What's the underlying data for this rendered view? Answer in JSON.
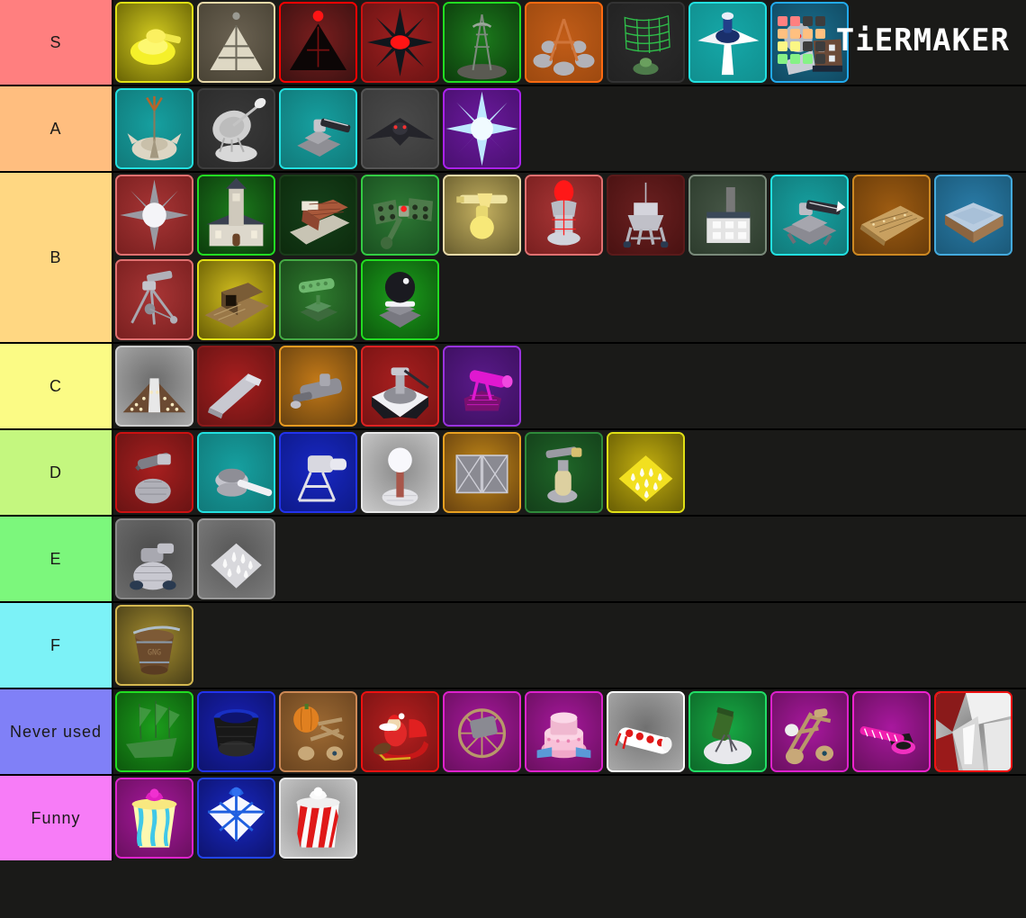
{
  "brand": {
    "name": "TiERMAKER",
    "logo_icon": "tiermaker-grid-logo",
    "grid_colors": [
      "#ff8080",
      "#ff8080",
      "#3d3d3d",
      "#3d3d3d",
      "#ffc080",
      "#ffc080",
      "#ffc080",
      "#ffc080",
      "#fbf785",
      "#fbf785",
      "#3d3d3d",
      "#3d3d3d",
      "#86f286",
      "#86f286",
      "#86f286",
      "#3d3d3d"
    ]
  },
  "background_color": "#1a1a18",
  "tiers": [
    {
      "label": "S",
      "color": "#ff7f7f",
      "items": [
        {
          "name": "yellow-tank-turret",
          "bg": "#6b6605",
          "bg2": "#d4cc20",
          "border": "#e0e015",
          "art": "tank"
        },
        {
          "name": "white-pyramid-structure",
          "bg": "#4a4436",
          "bg2": "#6b6252",
          "border": "#e8d9a8",
          "art": "pyramid-white"
        },
        {
          "name": "black-red-pyramid",
          "bg": "#3d1212",
          "bg2": "#7a1e1e",
          "border": "#ff0000",
          "art": "pyramid-dark"
        },
        {
          "name": "red-core-spike-burst",
          "bg": "#6b1414",
          "bg2": "#9e1f1f",
          "border": "#cc1111",
          "art": "spike-burst-red"
        },
        {
          "name": "green-radio-tower",
          "bg": "#0d3d0d",
          "bg2": "#1c7a1c",
          "border": "#22dd22",
          "art": "radio-tower"
        },
        {
          "name": "orange-stone-campfire",
          "bg": "#9e4a10",
          "bg2": "#c25d18",
          "border": "#ff6a10",
          "art": "campfire"
        },
        {
          "name": "green-solar-panel-array",
          "bg": "#222222",
          "bg2": "#2c2c2c",
          "border": "#333333",
          "art": "solar-array"
        },
        {
          "name": "teal-blue-aircraft",
          "bg": "#119090",
          "bg2": "#15a8a8",
          "border": "#22e0e0",
          "art": "jet-plane"
        },
        {
          "name": "blue-radar-base-building",
          "bg": "#104a63",
          "bg2": "#1b6e8c",
          "border": "#22aaee",
          "art": "radar-building"
        }
      ]
    },
    {
      "label": "A",
      "color": "#ffbe7f",
      "items": [
        {
          "name": "teal-antenna-dome",
          "bg": "#117a7a",
          "bg2": "#16a0a0",
          "border": "#22e0e0",
          "art": "antenna-dome"
        },
        {
          "name": "satellite-dish-grey",
          "bg": "#2b2b2b",
          "bg2": "#3a3a3a",
          "border": "#3d3d3d",
          "art": "satellite-dish"
        },
        {
          "name": "teal-artillery-platform",
          "bg": "#117a7a",
          "bg2": "#16a0a0",
          "border": "#22e0e0",
          "art": "artillery"
        },
        {
          "name": "stealth-bomber-grey",
          "bg": "#3a3a3a",
          "bg2": "#4a4a4a",
          "border": "#555555",
          "art": "stealth-bomber"
        },
        {
          "name": "purple-ice-star-burst",
          "bg": "#4a1070",
          "bg2": "#6b1a9e",
          "border": "#aa22ee",
          "art": "star-burst-ice"
        }
      ]
    },
    {
      "label": "B",
      "color": "#ffd782",
      "items": [
        {
          "name": "white-spiked-orb",
          "bg": "#7a2020",
          "bg2": "#a83535",
          "border": "#e07070",
          "art": "spiked-orb"
        },
        {
          "name": "green-church-building",
          "bg": "#0d3d0d",
          "bg2": "#1c7a1c",
          "border": "#22dd22",
          "art": "church"
        },
        {
          "name": "dark-brick-wall-platform",
          "bg": "#0d2b0d",
          "bg2": "#15401a",
          "border": "#1a3d1a",
          "art": "brick-wall"
        },
        {
          "name": "green-circuit-launcher",
          "bg": "#1a5020",
          "bg2": "#2e7a35",
          "border": "#33cc44",
          "art": "circuit-launcher"
        },
        {
          "name": "yellow-crane-hammer",
          "bg": "#6b6030",
          "bg2": "#c4b060",
          "border": "#e8d9a8",
          "art": "crane-hammer"
        },
        {
          "name": "red-capsule-silo",
          "bg": "#7a2020",
          "bg2": "#a83535",
          "border": "#e07070",
          "art": "capsule-silo"
        },
        {
          "name": "grey-drilling-rig",
          "bg": "#4a1212",
          "bg2": "#6b2020",
          "border": "#5a1a1a",
          "art": "drill-rig"
        },
        {
          "name": "factory-smokestack",
          "bg": "#2e3d2e",
          "bg2": "#455545",
          "border": "#7a8a7a",
          "art": "factory"
        },
        {
          "name": "teal-heavy-cannon",
          "bg": "#117a7a",
          "bg2": "#16a0a0",
          "border": "#22e0e0",
          "art": "heavy-cannon"
        },
        {
          "name": "wooden-plank-ramp",
          "bg": "#6b3d0a",
          "bg2": "#9e5c12",
          "border": "#cc8822",
          "art": "wood-ramp"
        },
        {
          "name": "blue-water-basin",
          "bg": "#1b5a7a",
          "bg2": "#2a7ca8",
          "border": "#44aadd",
          "art": "water-basin"
        },
        {
          "name": "red-tripod-launcher",
          "bg": "#7a2020",
          "bg2": "#a83535",
          "border": "#e07070",
          "art": "tripod-launcher"
        },
        {
          "name": "yellow-wooden-bunker",
          "bg": "#6b6005",
          "bg2": "#d4c020",
          "border": "#e0e015",
          "art": "bunker"
        },
        {
          "name": "green-gatling-turret",
          "bg": "#1a4a1a",
          "bg2": "#2e7a2e",
          "border": "#44aa44",
          "art": "gatling"
        },
        {
          "name": "green-black-dome-turret",
          "bg": "#0d5a0d",
          "bg2": "#1c9e1c",
          "border": "#22dd22",
          "art": "dome-turret"
        }
      ]
    },
    {
      "label": "C",
      "color": "#fbfb85",
      "items": [
        {
          "name": "grey-studded-ramp",
          "bg": "#a8a8a8",
          "bg2": "#6b6b6b",
          "border": "#cccccc",
          "art": "studded-ramp"
        },
        {
          "name": "red-grey-blade-ramp",
          "bg": "#6b1414",
          "bg2": "#a81f1f",
          "border": "#8a1a1a",
          "art": "blade-ramp"
        },
        {
          "name": "orange-grey-barrel",
          "bg": "#6b4410",
          "bg2": "#c47a18",
          "border": "#e89a20",
          "art": "barrel-cannon"
        },
        {
          "name": "red-radar-turret-platform",
          "bg": "#7a1414",
          "bg2": "#a81f1f",
          "border": "#dd2222",
          "art": "radar-turret"
        },
        {
          "name": "purple-magenta-cannon",
          "bg": "#3d1060",
          "bg2": "#5a1a8a",
          "border": "#9933dd",
          "art": "magenta-cannon"
        }
      ]
    },
    {
      "label": "D",
      "color": "#c4f77f",
      "items": [
        {
          "name": "red-mounted-machine-gun",
          "bg": "#6b1414",
          "bg2": "#a81f1f",
          "border": "#cc1111",
          "art": "machine-gun"
        },
        {
          "name": "teal-mortar-launcher",
          "bg": "#117a7a",
          "bg2": "#16a0a0",
          "border": "#22e0e0",
          "art": "mortar"
        },
        {
          "name": "blue-searchlight-tower",
          "bg": "#0e1a8a",
          "bg2": "#1828c4",
          "border": "#2233ee",
          "art": "searchlight"
        },
        {
          "name": "white-ball-antenna",
          "bg": "#c8c8c8",
          "bg2": "#8a8a8a",
          "border": "#e8e8e8",
          "art": "ball-antenna"
        },
        {
          "name": "orange-mesh-double-gate",
          "bg": "#6b4410",
          "bg2": "#c48a18",
          "border": "#e8a020",
          "art": "mesh-gate"
        },
        {
          "name": "green-fuel-tank-turret",
          "bg": "#14401a",
          "bg2": "#1f6628",
          "border": "#2e8a3a",
          "art": "fuel-turret"
        },
        {
          "name": "yellow-spike-trap-plate",
          "bg": "#6b6005",
          "bg2": "#c4b010",
          "border": "#e0e015",
          "art": "spike-plate-yellow"
        }
      ]
    },
    {
      "label": "E",
      "color": "#7cf77c",
      "items": [
        {
          "name": "grey-mesh-turret",
          "bg": "#6b6b6b",
          "bg2": "#4a4a4a",
          "border": "#888888",
          "art": "mesh-turret"
        },
        {
          "name": "grey-spike-trap-plate",
          "bg": "#7a7a7a",
          "bg2": "#555555",
          "border": "#999999",
          "art": "spike-plate-grey"
        }
      ]
    },
    {
      "label": "F",
      "color": "#7cf2f7",
      "items": [
        {
          "name": "brown-bucket-container",
          "bg": "#4a4018",
          "bg2": "#a89030",
          "border": "#d4b850",
          "art": "bucket"
        }
      ]
    },
    {
      "label": "Never used",
      "color": "#8080f7",
      "items": [
        {
          "name": "green-sailing-ship",
          "bg": "#0d5a0d",
          "bg2": "#1c9e1c",
          "border": "#22dd22",
          "art": "sail-ship"
        },
        {
          "name": "blue-mesh-drum",
          "bg": "#0e1470",
          "bg2": "#1820b8",
          "border": "#2233ee",
          "art": "drum"
        },
        {
          "name": "pumpkin-catapult",
          "bg": "#6b4520",
          "bg2": "#9e6a33",
          "border": "#cc8855",
          "art": "pumpkin-catapult"
        },
        {
          "name": "red-santa-sleigh",
          "bg": "#7a1414",
          "bg2": "#b81f1f",
          "border": "#ee1111",
          "art": "sleigh"
        },
        {
          "name": "magenta-wheel-cart-cannon",
          "bg": "#6b1060",
          "bg2": "#a8189e",
          "border": "#dd22cc",
          "art": "wheel-cannon"
        },
        {
          "name": "pink-cake-tower",
          "bg": "#6b1060",
          "bg2": "#a8189e",
          "border": "#dd22cc",
          "art": "cake"
        },
        {
          "name": "candy-cane-cannon",
          "bg": "#a8a8a8",
          "bg2": "#707070",
          "border": "#ffffff",
          "art": "candy-cannon"
        },
        {
          "name": "green-snow-mortar",
          "bg": "#0d6b2a",
          "bg2": "#18a844",
          "border": "#22dd66",
          "art": "snow-mortar"
        },
        {
          "name": "wooden-catapult",
          "bg": "#6b1060",
          "bg2": "#a8189e",
          "border": "#dd22cc",
          "art": "catapult"
        },
        {
          "name": "pink-candy-cane-beam",
          "bg": "#6b1060",
          "bg2": "#a8189e",
          "border": "#ee22cc",
          "art": "candy-beam"
        },
        {
          "name": "white-red-crystal-shard",
          "bg": "#cccccc",
          "bg2": "#888888",
          "border": "#ee1111",
          "art": "crystal-shard"
        }
      ]
    },
    {
      "label": "Funny",
      "color": "#f77cf7",
      "items": [
        {
          "name": "magenta-striped-gift-box",
          "bg": "#6b1060",
          "bg2": "#a8189e",
          "border": "#dd22cc",
          "art": "gift-magenta"
        },
        {
          "name": "blue-striped-gift-box",
          "bg": "#0e1470",
          "bg2": "#1828c4",
          "border": "#2244ee",
          "art": "gift-blue"
        },
        {
          "name": "red-striped-gift-box",
          "bg": "#c8c8c8",
          "bg2": "#8a8a8a",
          "border": "#e8e8e8",
          "art": "gift-red"
        }
      ]
    }
  ]
}
